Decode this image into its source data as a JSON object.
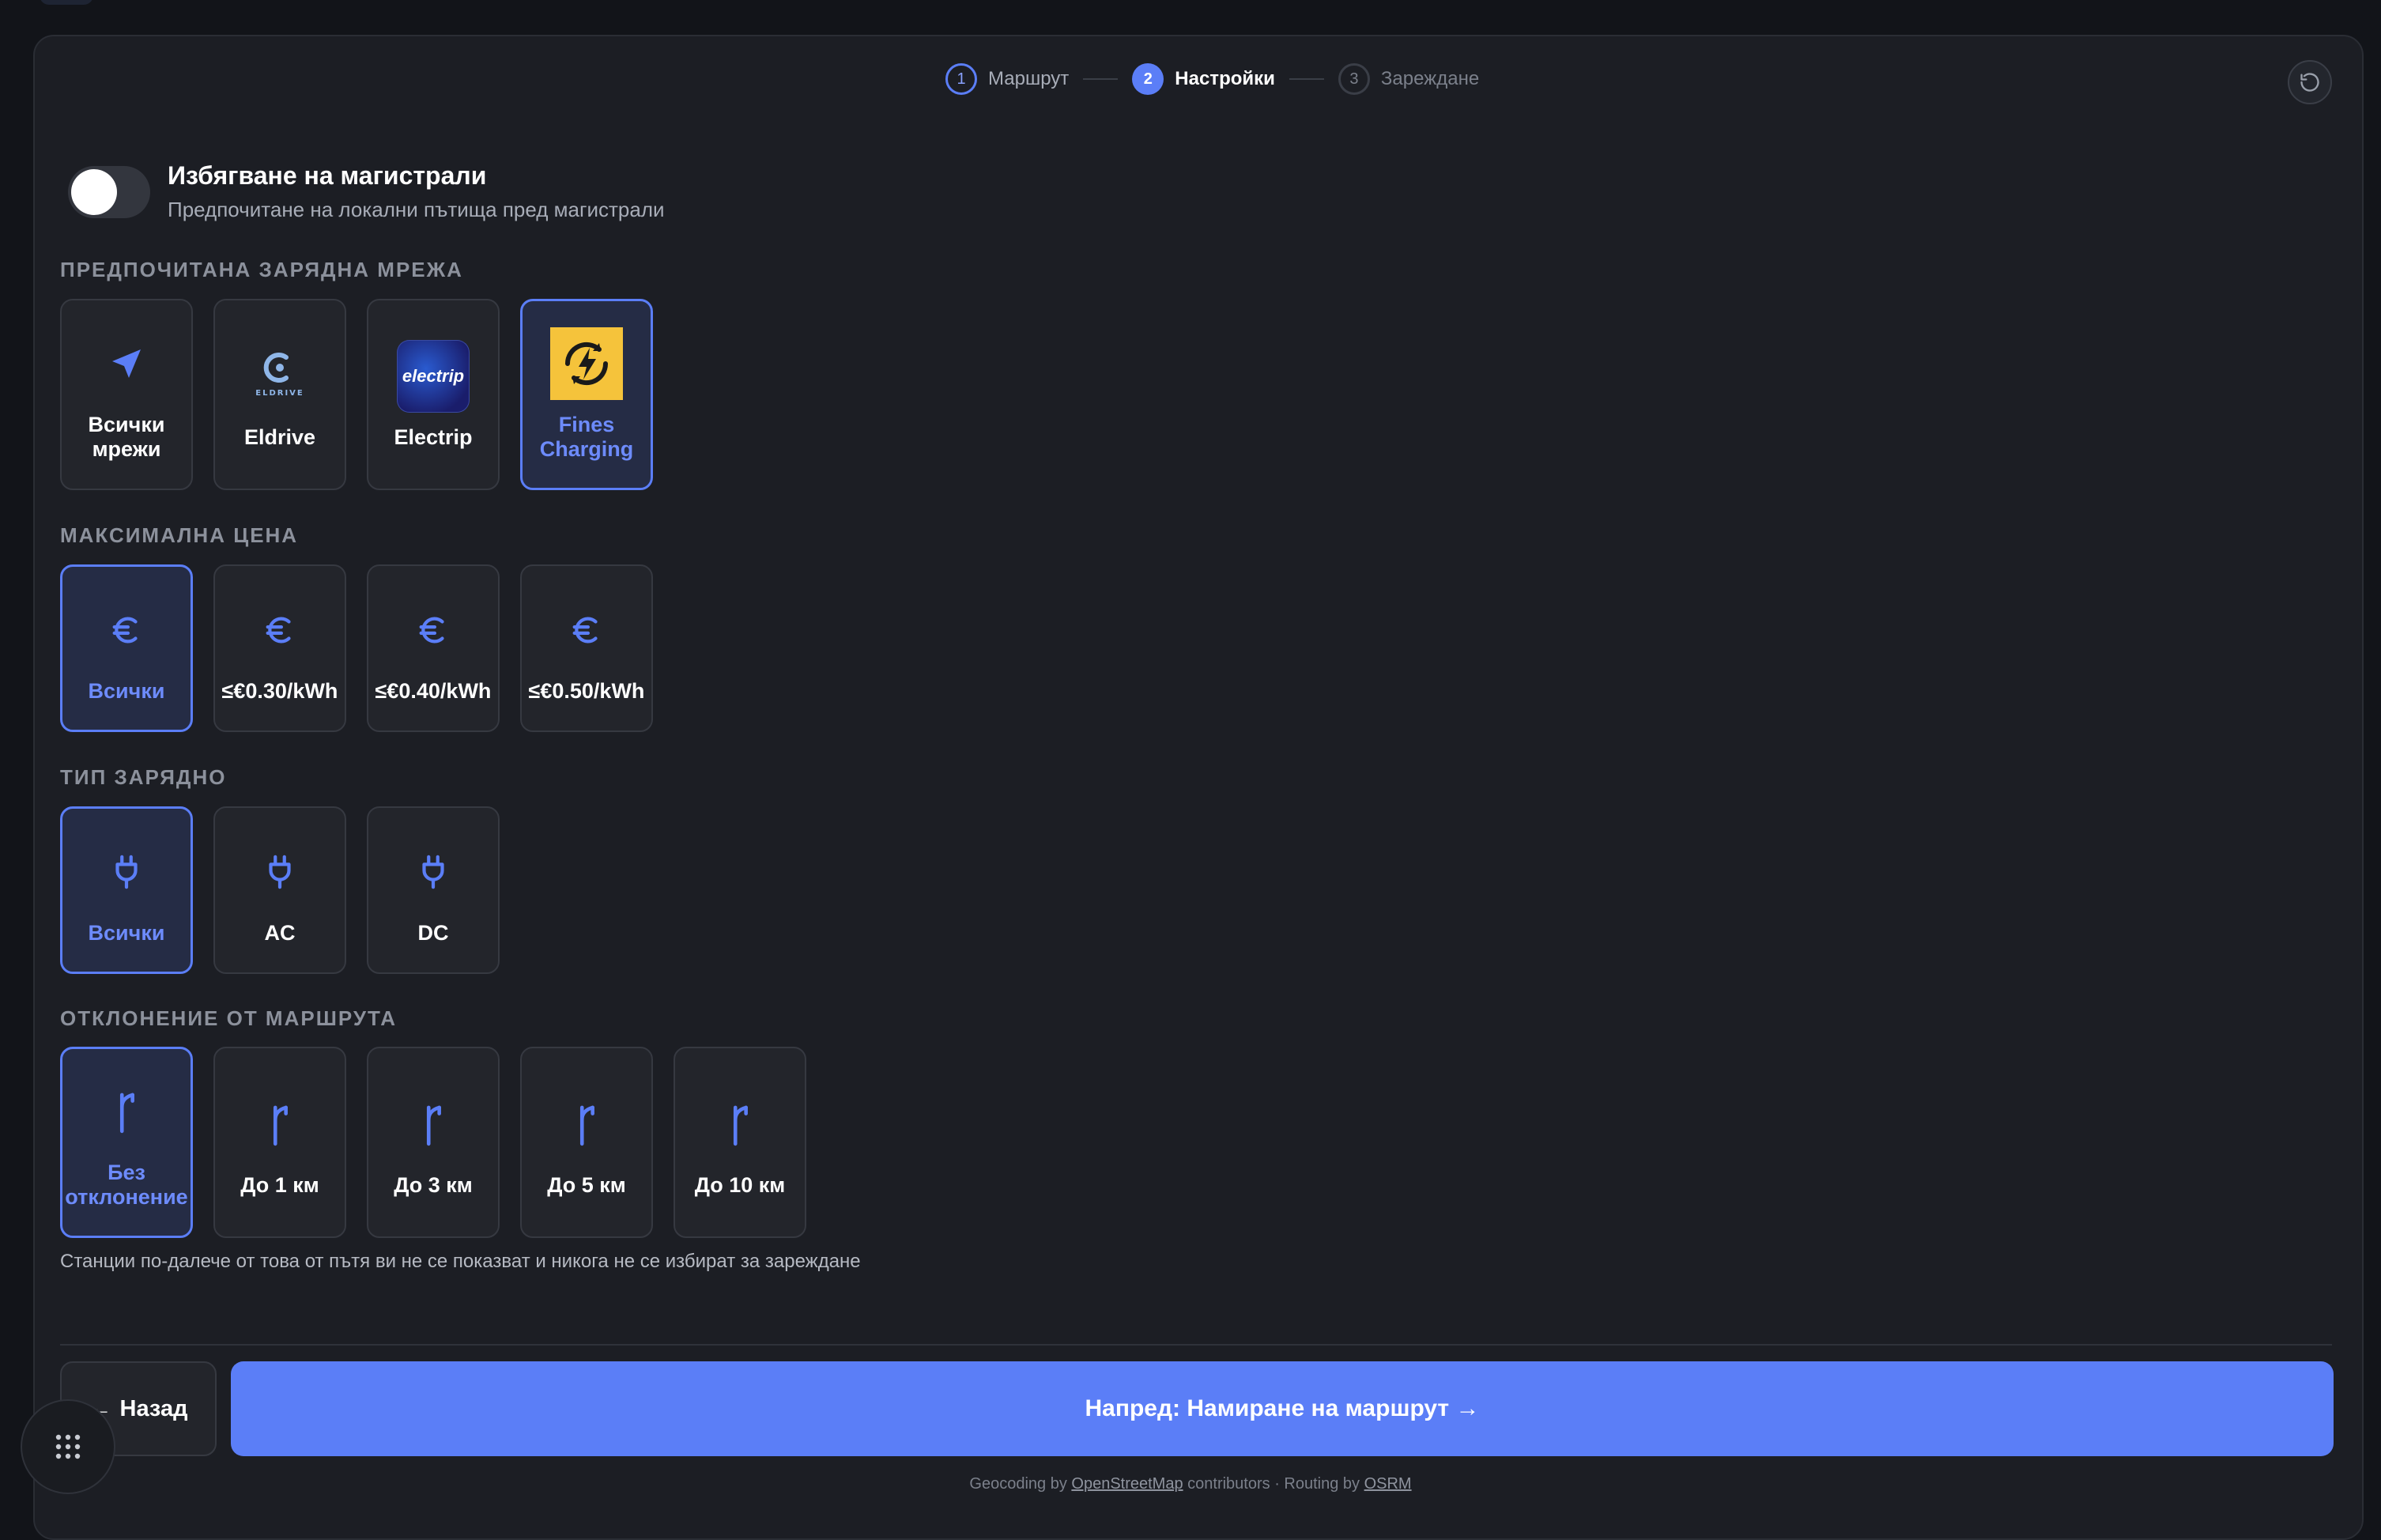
{
  "stepper": {
    "steps": [
      {
        "number": "1",
        "label": "Маршрут"
      },
      {
        "number": "2",
        "label": "Настройки"
      },
      {
        "number": "3",
        "label": "Зареждане"
      }
    ],
    "active_step": 2
  },
  "avoid_highways": {
    "title": "Избягване на магистрали",
    "description": "Предпочитане на локални пътища пред магистрали",
    "enabled": false
  },
  "network": {
    "title": "ПРЕДПОЧИТАНА ЗАРЯДНА МРЕЖА",
    "options": [
      {
        "line1": "Всички",
        "line2": "мрежи",
        "icon": "navigation-arrow-icon"
      },
      {
        "line1": "Eldrive",
        "line2": "",
        "icon": "eldrive-logo"
      },
      {
        "line1": "Electrip",
        "line2": "",
        "icon": "electrip-logo"
      },
      {
        "line1": "Fines",
        "line2": "Charging",
        "icon": "fines-charging-logo"
      }
    ],
    "selected": "Fines Charging"
  },
  "logos": {
    "eldrive_text": "ELDRIVE",
    "electrip_text": "electrip"
  },
  "max_price": {
    "title": "МАКСИМАЛНА ЦЕНА",
    "options": [
      "Всички",
      "≤€0.30/kWh",
      "≤€0.40/kWh",
      "≤€0.50/kWh"
    ],
    "icon": "euro-icon",
    "selected": "Всички"
  },
  "charger_type": {
    "title": "ТИП ЗАРЯДНО",
    "options": [
      "Всички",
      "AC",
      "DC"
    ],
    "icon": "plug-icon",
    "selected": "Всички"
  },
  "detour": {
    "title": "ОТКЛОНЕНИЕ ОТ МАРШРУТА",
    "options": [
      {
        "line1": "Без",
        "line2": "отклонение"
      },
      {
        "line1": "До 1 км",
        "line2": ""
      },
      {
        "line1": "До 3 км",
        "line2": ""
      },
      {
        "line1": "До 5 км",
        "line2": ""
      },
      {
        "line1": "До 10 км",
        "line2": ""
      }
    ],
    "icon": "detour-icon",
    "selected": "Без отклонение",
    "hint": "Станции по-далече от това от пътя ви не се показват и никога не се избират за зареждане"
  },
  "actions": {
    "back_label": "Назад",
    "back_arrow": "←",
    "next_label": "Напред: Намиране на маршрут →"
  },
  "footer": {
    "prefix": "Geocoding by ",
    "osm_link": "OpenStreetMap",
    "middle": " contributors · Routing by ",
    "osrm_link": "OSRM"
  },
  "colors": {
    "accent": "#5b7ef7",
    "background": "#121419",
    "card": "#1c1e24",
    "fines_yellow": "#f5c33b"
  }
}
